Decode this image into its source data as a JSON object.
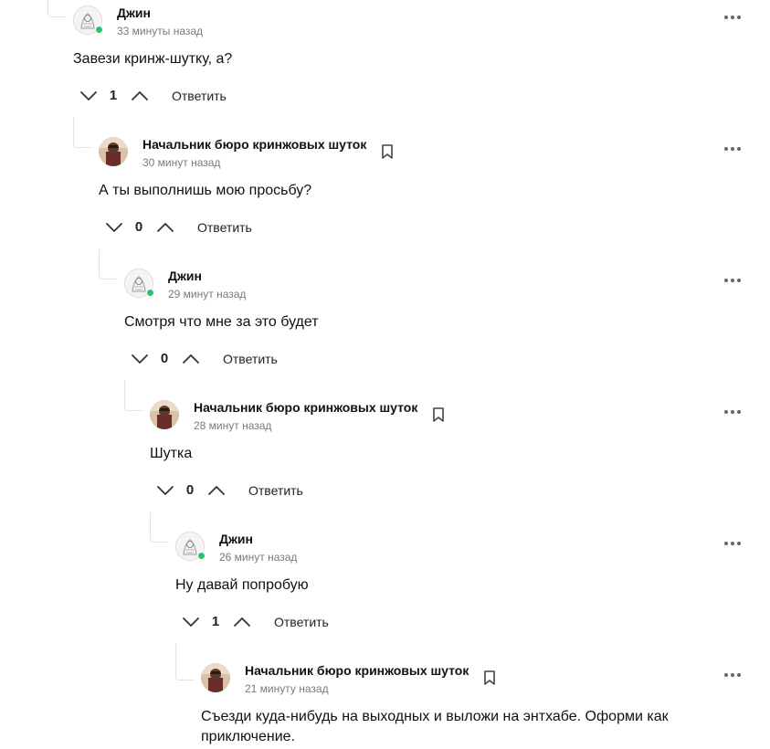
{
  "ui": {
    "reply_label": "Ответить",
    "accent_online": "#2ac26b",
    "icons": {
      "more": "more-dots-icon",
      "bookmark": "bookmark-icon",
      "vote_down": "chevron-down-icon",
      "vote_up": "chevron-up-icon"
    }
  },
  "comments": [
    {
      "author": "Джин",
      "time": "33 минуты назад",
      "text": "Завези кринж-шутку, а?",
      "votes": "1",
      "online": true,
      "bookmark": false
    },
    {
      "author": "Начальник бюро кринжовых шуток",
      "time": "30 минут назад",
      "text": "А ты выполнишь мою просьбу?",
      "votes": "0",
      "online": false,
      "bookmark": true
    },
    {
      "author": "Джин",
      "time": "29 минут назад",
      "text": "Смотря что мне за это будет",
      "votes": "0",
      "online": true,
      "bookmark": false
    },
    {
      "author": "Начальник бюро кринжовых шуток",
      "time": "28 минут назад",
      "text": "Шутка",
      "votes": "0",
      "online": false,
      "bookmark": true
    },
    {
      "author": "Джин",
      "time": "26 минут назад",
      "text": "Ну давай попробую",
      "votes": "1",
      "online": true,
      "bookmark": false
    },
    {
      "author": "Начальник бюро кринжовых шуток",
      "time": "21 минуту назад",
      "text": "Съезди куда-нибудь на выходных и выложи на энтхабе. Оформи как приключение.",
      "votes": "",
      "online": false,
      "bookmark": true
    }
  ]
}
